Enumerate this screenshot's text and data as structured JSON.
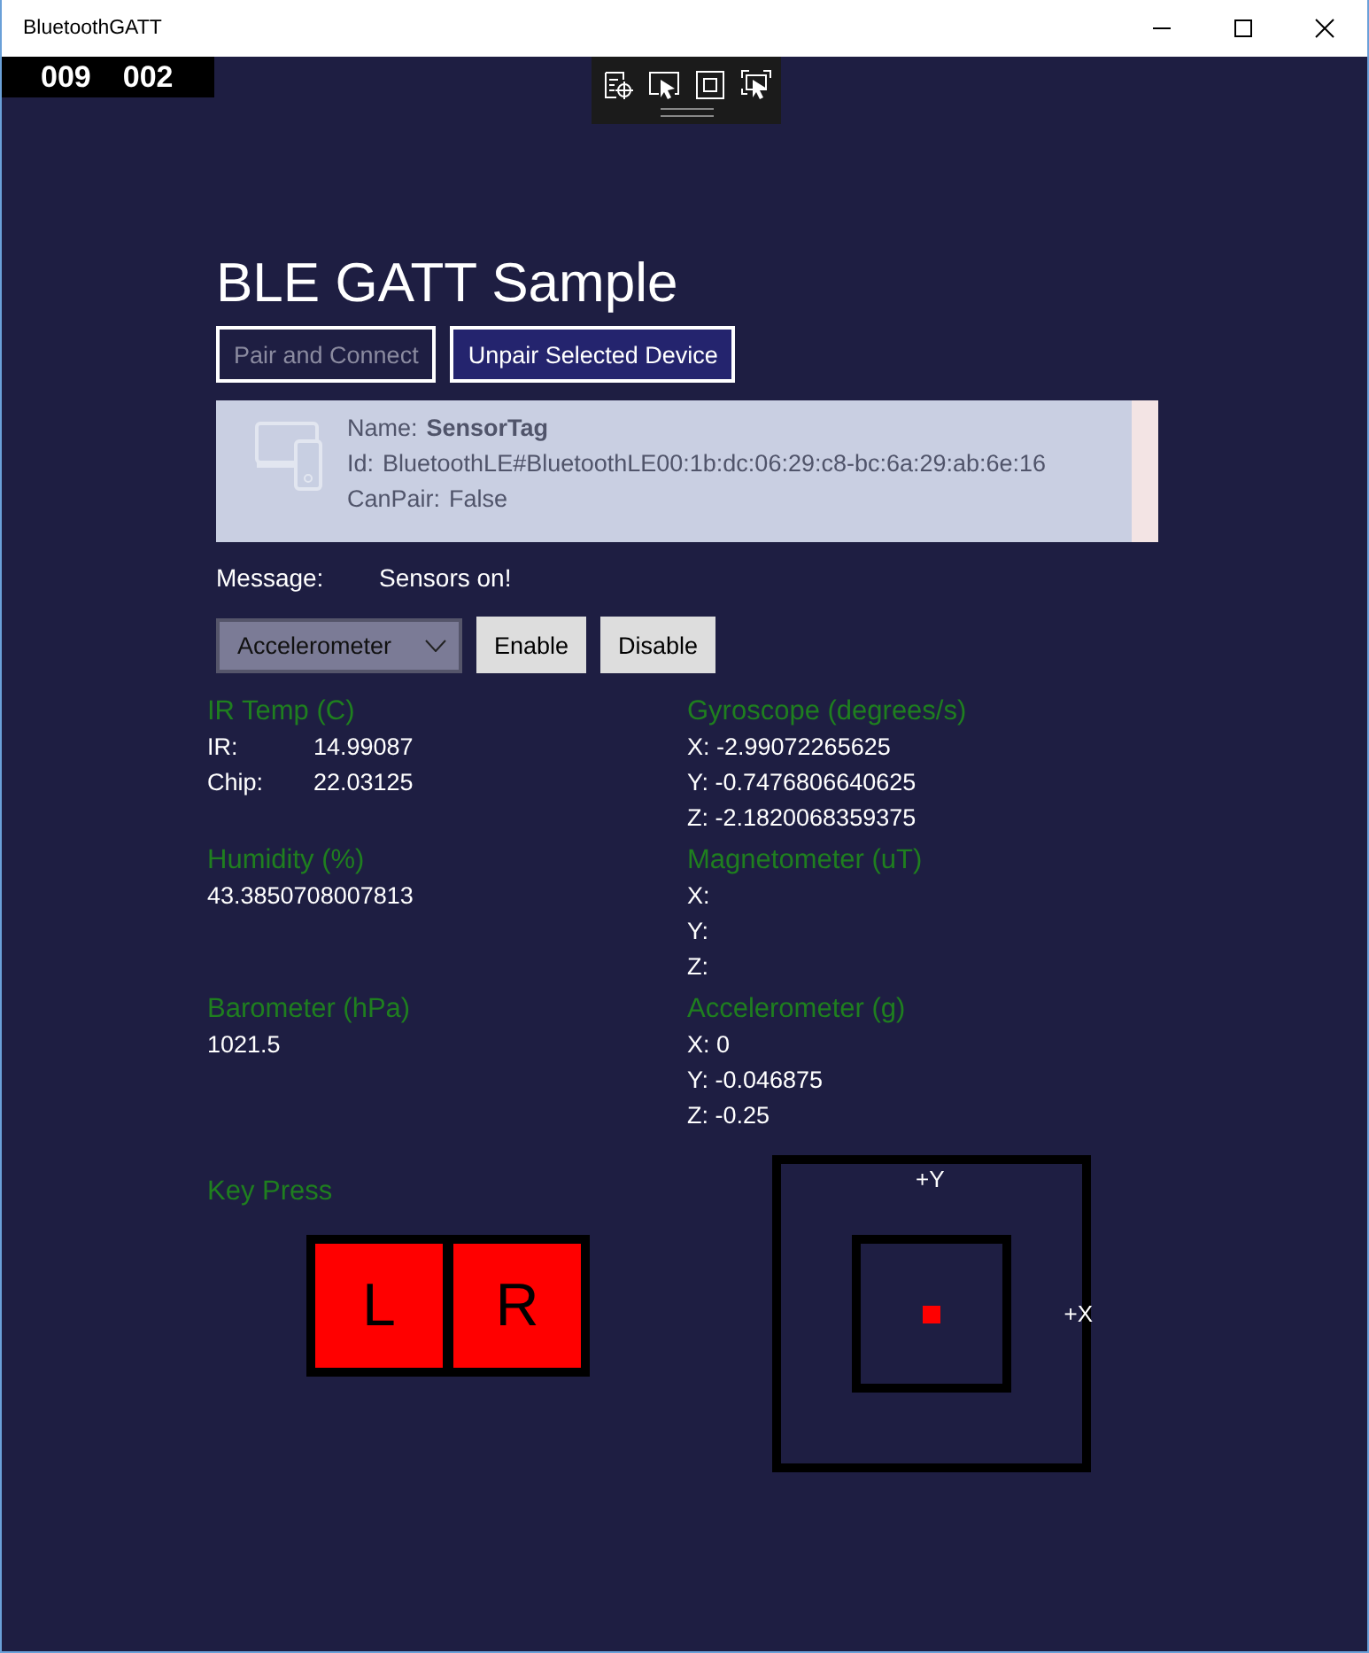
{
  "window": {
    "title": "BluetoothGATT"
  },
  "frame_counters": [
    "009",
    "002"
  ],
  "title": "BLE GATT Sample",
  "buttons": [
    {
      "label": "Pair and Connect",
      "disabled": true
    },
    {
      "label": "Unpair Selected Device",
      "disabled": false
    }
  ],
  "device_list": [
    {
      "selected": true,
      "fields": [
        {
          "label": "Name:",
          "value": "SensorTag",
          "bold": true
        },
        {
          "label": "Id:",
          "value": "BluetoothLE#BluetoothLE00:1b:dc:06:29:c8-bc:6a:29:ab:6e:16",
          "bold": false
        },
        {
          "label": "CanPair:",
          "value": "False",
          "bold": false
        }
      ]
    }
  ],
  "message": {
    "label": "Message:",
    "value": "Sensors on!"
  },
  "sensor_select": {
    "value": "Accelerometer"
  },
  "sensor_buttons": [
    "Enable",
    "Disable"
  ],
  "sensors_left": [
    {
      "title": "IR Temp (C)",
      "kind": "pairs",
      "rows": [
        {
          "label": "IR:",
          "value": "14.99087"
        },
        {
          "label": "Chip:",
          "value": "22.03125"
        }
      ]
    },
    {
      "title": "Humidity (%)",
      "kind": "lines",
      "rows": [
        "43.3850708007813"
      ]
    },
    {
      "title": "Barometer (hPa)",
      "kind": "lines",
      "rows": [
        "1021.5"
      ]
    }
  ],
  "sensors_right": [
    {
      "title": "Gyroscope (degrees/s)",
      "kind": "lines",
      "rows": [
        "X: -2.99072265625",
        "Y: -0.7476806640625",
        "Z: -2.1820068359375"
      ]
    },
    {
      "title": "Magnetometer (uT)",
      "kind": "lines",
      "rows": [
        "X:",
        "Y:",
        "Z:"
      ]
    },
    {
      "title": "Accelerometer (g)",
      "kind": "lines",
      "rows": [
        "X: 0",
        "Y: -0.046875",
        "Z: -0.25"
      ]
    }
  ],
  "key_press": {
    "title": "Key Press",
    "keys": [
      {
        "label": "L",
        "pressed": true
      },
      {
        "label": "R",
        "pressed": true
      }
    ]
  },
  "accel_plot": {
    "y_label": "+Y",
    "x_label": "+X"
  }
}
